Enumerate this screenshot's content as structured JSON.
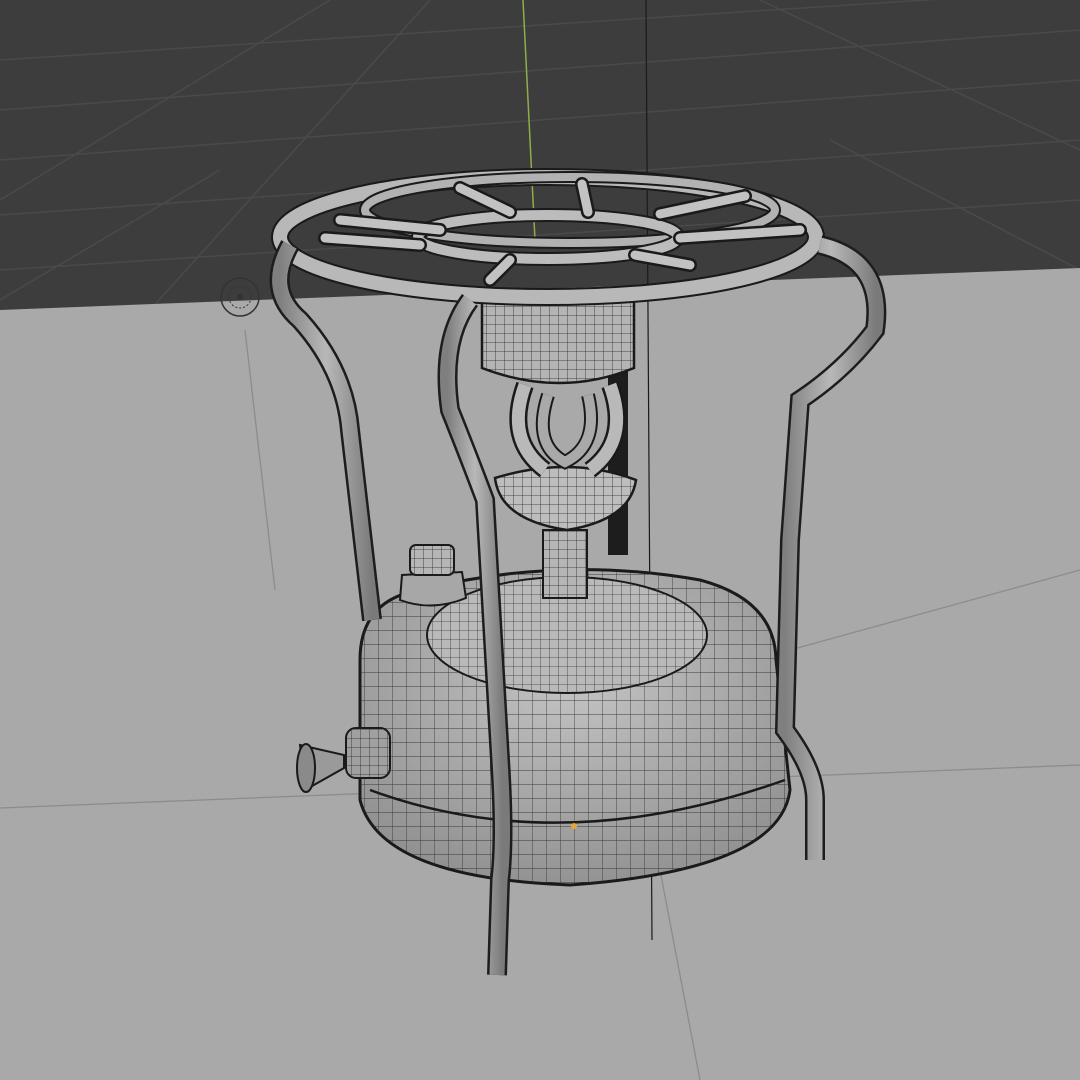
{
  "viewport": {
    "kind": "3d-viewport",
    "shading": "solid",
    "wireframe_overlay": true,
    "colors": {
      "world_background": "#3d3d3d",
      "floor_grid_line": "#4a4a4a",
      "floor_plane": "#a9a9a9",
      "mesh_fill": "#b4b4b4",
      "mesh_fill_dark": "#8e8e8e",
      "wire": "#1a1a1a",
      "y_axis": "#8fae4a",
      "origin_dot": "#e8a53a"
    }
  },
  "scene": {
    "object": "kerosene-stove",
    "parts": [
      "pot-ring",
      "burner-cup",
      "vaporizer-loop",
      "burner-bowl",
      "tank",
      "filler-cap",
      "pump-valve",
      "legs"
    ],
    "light_gizmo": "point-light-icon",
    "origin_marker": "object-origin-dot"
  }
}
